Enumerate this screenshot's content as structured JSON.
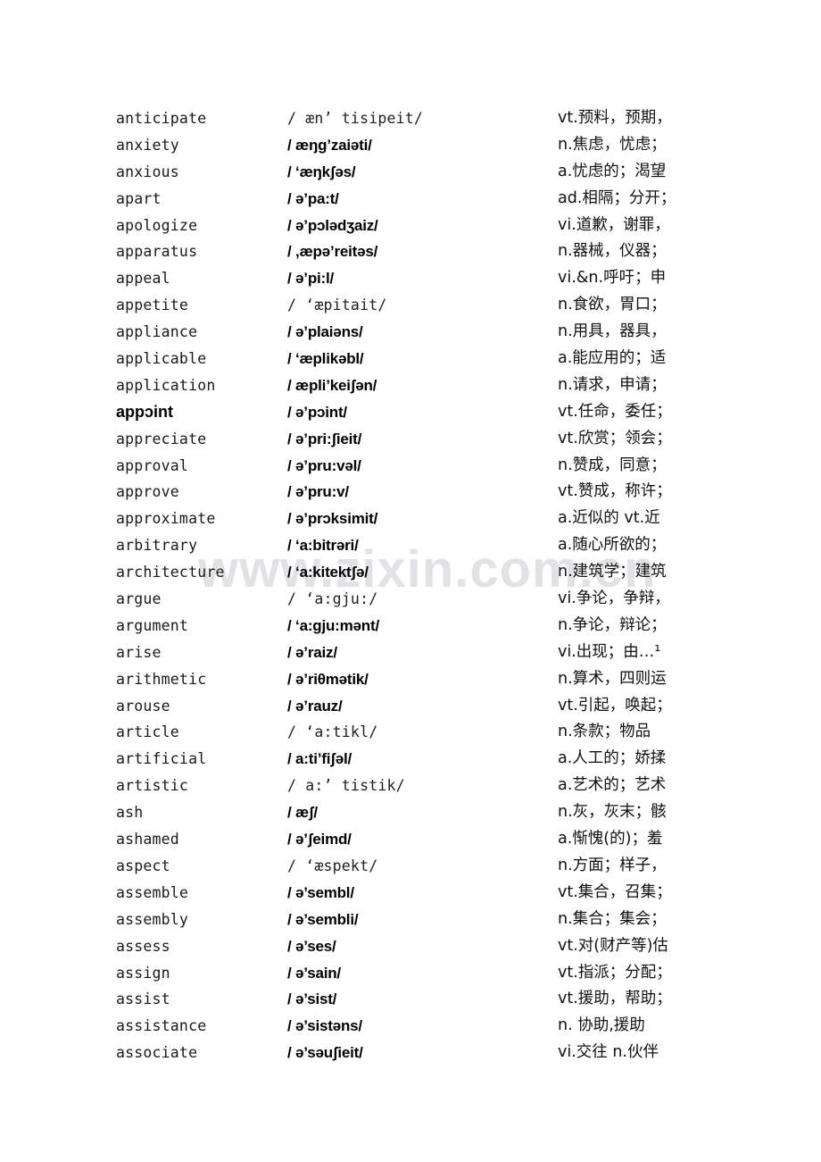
{
  "watermark": {
    "text": "www.zixin.com.cn"
  },
  "entries": [
    {
      "word": "anticipate",
      "word_style": "serif",
      "phonetic": "/ æn’ tisipeit/",
      "phonetic_style": "serif",
      "definition": "vt.预料，预期，"
    },
    {
      "word": "anxiety",
      "word_style": "serif",
      "phonetic": "/ æŋg’zaiəti/",
      "phonetic_style": "sans",
      "definition": "n.焦虑，忧虑；"
    },
    {
      "word": "anxious",
      "word_style": "serif",
      "phonetic": "/ ‘æŋkʃəs/",
      "phonetic_style": "sans",
      "definition": "a.忧虑的；渴望"
    },
    {
      "word": "apart",
      "word_style": "serif",
      "phonetic": "/ ə’pa:t/",
      "phonetic_style": "sans",
      "definition": "ad.相隔；分开；"
    },
    {
      "word": "apologize",
      "word_style": "serif",
      "phonetic": "/ ə’pɔlədʒaiz/",
      "phonetic_style": "sans",
      "definition": "vi.道歉，谢罪，"
    },
    {
      "word": "apparatus",
      "word_style": "serif",
      "phonetic": "/ ,æpə’reitəs/",
      "phonetic_style": "sans",
      "definition": "n.器械，仪器；"
    },
    {
      "word": "appeal",
      "word_style": "serif",
      "phonetic": "/ ə’pi:l/",
      "phonetic_style": "sans",
      "definition": "vi.&n.呼吁；申"
    },
    {
      "word": "appetite",
      "word_style": "serif",
      "phonetic": "/   ‘æpitait/",
      "phonetic_style": "serif",
      "definition": "n.食欲，胃口；"
    },
    {
      "word": "appliance",
      "word_style": "serif",
      "phonetic": "/ ə’plaiəns/",
      "phonetic_style": "sans",
      "definition": "n.用具，器具，"
    },
    {
      "word": "applicable",
      "word_style": "serif",
      "phonetic": "/ ‘æplikəbl/",
      "phonetic_style": "sans",
      "definition": "a.能应用的；适"
    },
    {
      "word": "application",
      "word_style": "serif",
      "phonetic": "/ æpli’keiʃən/",
      "phonetic_style": "sans",
      "definition": "n.请求，申请；"
    },
    {
      "word": "appɔint",
      "word_style": "alt",
      "phonetic": "/ ə’pɔint/",
      "phonetic_style": "sans",
      "definition": "vt.任命，委任；"
    },
    {
      "word": "appreciate",
      "word_style": "serif",
      "phonetic": "/ ə’pri:ʃieit/",
      "phonetic_style": "sans",
      "definition": "vt.欣赏；领会；"
    },
    {
      "word": "approval",
      "word_style": "serif",
      "phonetic": "/ ə’pru:vəl/",
      "phonetic_style": "sans",
      "definition": "n.赞成，同意；"
    },
    {
      "word": "approve",
      "word_style": "serif",
      "phonetic": "/ ə’pru:v/",
      "phonetic_style": "sans",
      "definition": "vt.赞成，称许；"
    },
    {
      "word": "approximate",
      "word_style": "serif",
      "phonetic": "/ ə’prɔksimit/",
      "phonetic_style": "sans",
      "definition": "a.近似的 vt.近"
    },
    {
      "word": "arbitrary",
      "word_style": "serif",
      "phonetic": "/ ‘a:bitrəri/",
      "phonetic_style": "sans",
      "definition": "a.随心所欲的；"
    },
    {
      "word": "architecture",
      "word_style": "serif",
      "phonetic": "/ ‘a:kitektʃə/",
      "phonetic_style": "sans",
      "definition": "n.建筑学；建筑"
    },
    {
      "word": "argue",
      "word_style": "serif",
      "phonetic": "/   ‘a:gju:/",
      "phonetic_style": "serif",
      "definition": "vi.争论，争辩，"
    },
    {
      "word": "argument",
      "word_style": "serif",
      "phonetic": "/ ‘a:gju:mənt/",
      "phonetic_style": "sans",
      "definition": "n.争论，辩论；"
    },
    {
      "word": "arise",
      "word_style": "serif",
      "phonetic": "/ ə’raiz/",
      "phonetic_style": "sans",
      "definition": "vi.出现；由…¹"
    },
    {
      "word": "arithmetic",
      "word_style": "serif",
      "phonetic": "/ ə’riθmətik/",
      "phonetic_style": "sans",
      "definition": "n.算术，四则运"
    },
    {
      "word": "arouse",
      "word_style": "serif",
      "phonetic": "/ ə’rauz/",
      "phonetic_style": "sans",
      "definition": "vt.引起，唤起；"
    },
    {
      "word": "article",
      "word_style": "serif",
      "phonetic": "/   ‘a:tikl/",
      "phonetic_style": "serif",
      "definition": "n.条款；物品"
    },
    {
      "word": "artificial",
      "word_style": "serif",
      "phonetic": "/ a:ti’fiʃəl/",
      "phonetic_style": "sans",
      "definition": "a.人工的；娇揉"
    },
    {
      "word": "artistic",
      "word_style": "serif",
      "phonetic": "/ a:’ tistik/",
      "phonetic_style": "serif",
      "definition": "a.艺术的；艺术"
    },
    {
      "word": "ash",
      "word_style": "serif",
      "phonetic": "/ æʃ/",
      "phonetic_style": "sans",
      "definition": "n.灰，灰末；骸"
    },
    {
      "word": "ashamed",
      "word_style": "serif",
      "phonetic": "/ ə’ʃeimd/",
      "phonetic_style": "sans",
      "definition": "a.惭愧(的)；羞"
    },
    {
      "word": "aspect",
      "word_style": "serif",
      "phonetic": "/   ‘æspekt/",
      "phonetic_style": "serif",
      "definition": "n.方面；样子，"
    },
    {
      "word": "assemble",
      "word_style": "serif",
      "phonetic": "/ ə’sembl/",
      "phonetic_style": "sans",
      "definition": "vt.集合，召集；"
    },
    {
      "word": "assembly",
      "word_style": "serif",
      "phonetic": "/ ə’sembli/",
      "phonetic_style": "sans",
      "definition": "n.集合；集会；"
    },
    {
      "word": "assess",
      "word_style": "serif",
      "phonetic": "/ ə’ses/",
      "phonetic_style": "sans",
      "definition": "vt.对(财产等)估"
    },
    {
      "word": "assign",
      "word_style": "serif",
      "phonetic": "/ ə’sain/",
      "phonetic_style": "sans",
      "definition": "vt.指派；分配；"
    },
    {
      "word": "assist",
      "word_style": "serif",
      "phonetic": "/ ə’sist/",
      "phonetic_style": "sans",
      "definition": "vt.援助，帮助；"
    },
    {
      "word": "assistance",
      "word_style": "serif",
      "phonetic": "/ ə’sistəns/",
      "phonetic_style": "sans",
      "definition": "n. 协助,援助"
    },
    {
      "word": "associate",
      "word_style": "serif",
      "phonetic": "/ ə’səuʃieit/",
      "phonetic_style": "sans",
      "definition": "vi.交往 n.伙伴"
    }
  ]
}
